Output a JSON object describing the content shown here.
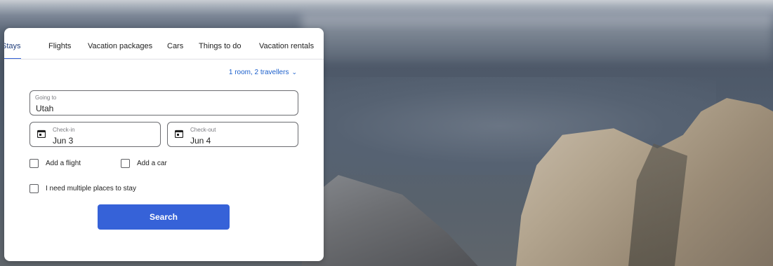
{
  "tabs": [
    {
      "label": "Stays",
      "active": true
    },
    {
      "label": "Flights"
    },
    {
      "label": "Vacation packages"
    },
    {
      "label": "Cars"
    },
    {
      "label": "Things to do"
    },
    {
      "label": "Vacation rentals"
    }
  ],
  "travellers": {
    "label": "1 room, 2 travellers"
  },
  "going_to": {
    "label": "Going to",
    "value": "Utah"
  },
  "check_in": {
    "label": "Check-in",
    "value": "Jun 3"
  },
  "check_out": {
    "label": "Check-out",
    "value": "Jun 4"
  },
  "options": {
    "add_flight": "Add a flight",
    "add_car": "Add a car",
    "multiple_places": "I need multiple places to stay"
  },
  "search": {
    "label": "Search"
  },
  "colors": {
    "accent": "#3662d8",
    "link": "#1b5fcb"
  },
  "icons": {
    "dates": "calendar-icon",
    "dropdown": "chevron-down-icon"
  }
}
